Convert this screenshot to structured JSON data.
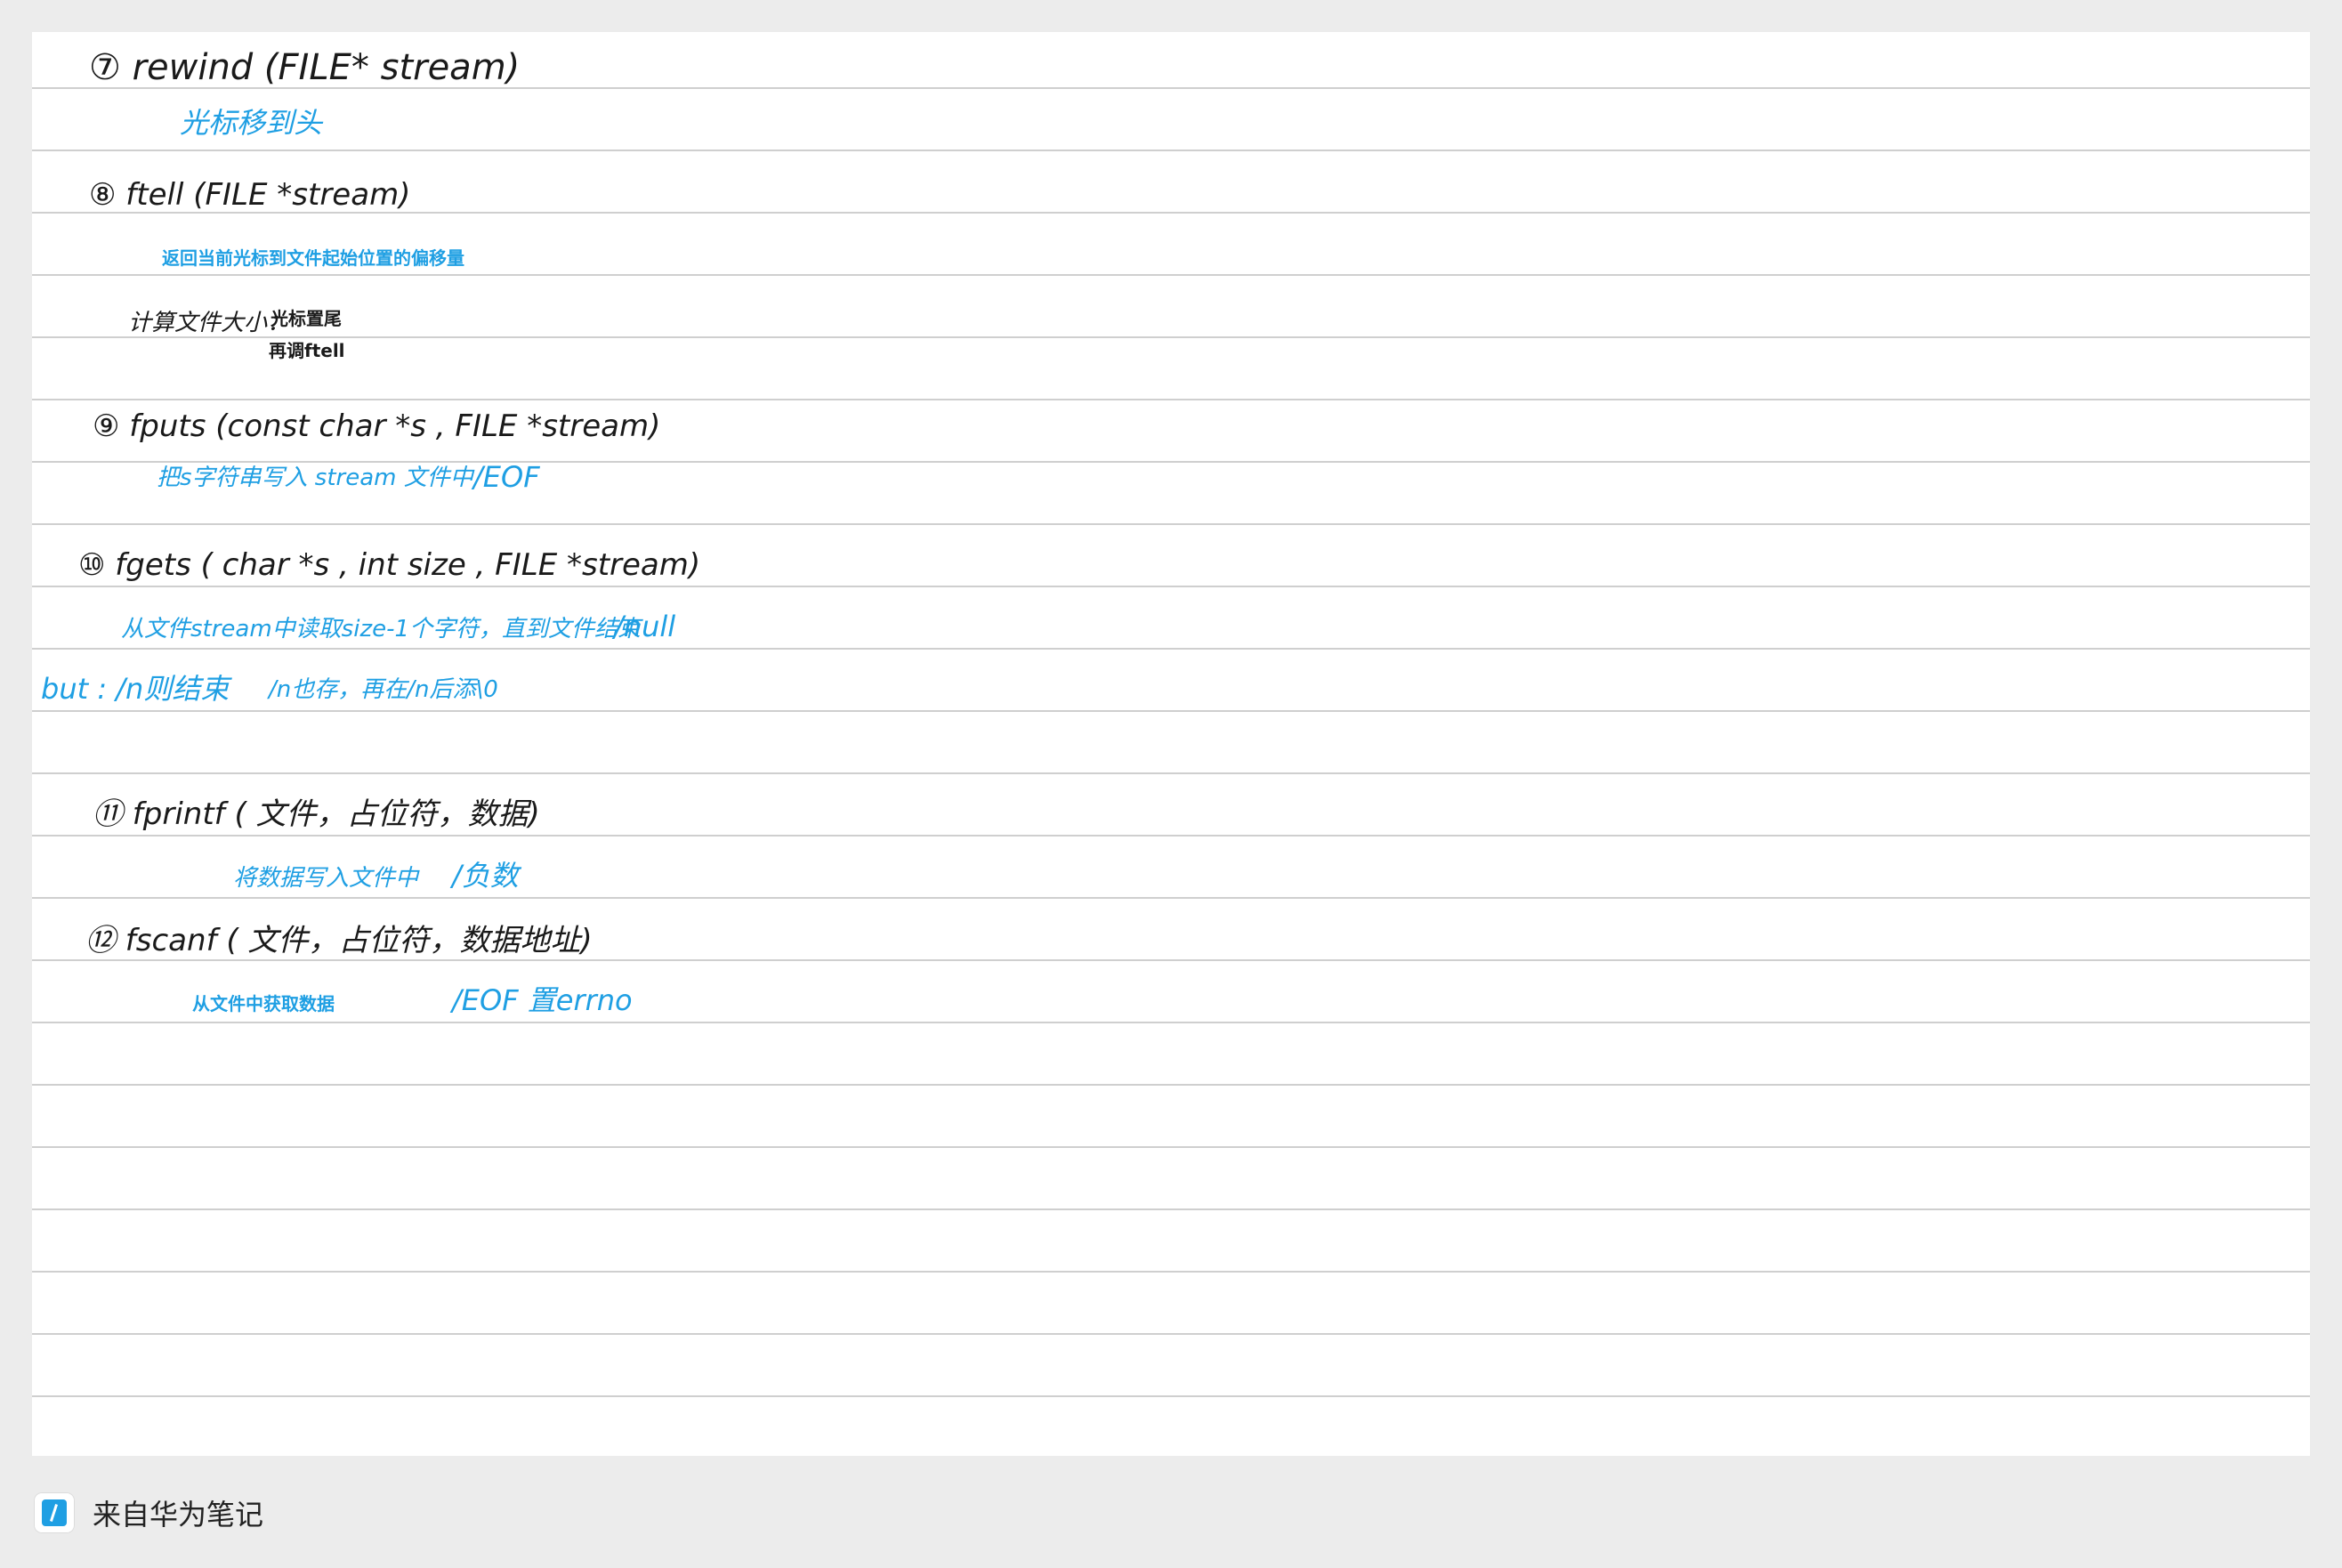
{
  "page": {
    "background": "#ececec",
    "paper": "#ffffff",
    "rule_color": "#cfcfcf",
    "ink_black": "#1a1a1a",
    "ink_blue": "#1f9fe3"
  },
  "notes": {
    "item7_title": "⑦  rewind (FILE* stream)",
    "item7_desc": "光标移到头",
    "item8_title": "⑧  ftell (FILE *stream)",
    "item8_desc": "返回当前光标到文件起始位置的偏移量",
    "item8_extra_label": "计算文件大小：",
    "item8_extra_line1": "光标置尾",
    "item8_extra_line2": "再调ftell",
    "item9_title": "⑨  fputs (const char *s , FILE *stream)",
    "item9_desc": "把s字符串写入 stream 文件中",
    "item9_return": "/EOF",
    "item10_title": "⑩  fgets ( char *s , int size , FILE *stream)",
    "item10_desc": "从文件stream中读取size-1个字符，直到文件结束",
    "item10_return": "/null",
    "item10_note_a": "but : /n则结束",
    "item10_note_b": "/n也存，再在/n后添\\0",
    "item11_title": "⑪  fprintf ( 文件，占位符，数据)",
    "item11_desc": "将数据写入文件中",
    "item11_return": "/负数",
    "item12_title": "⑫  fscanf ( 文件，占位符，数据地址)",
    "item12_desc": "从文件中获取数据",
    "item12_return": "/EOF  置errno"
  },
  "footer": {
    "icon": "huawei-notes-icon",
    "text": "来自华为笔记"
  }
}
